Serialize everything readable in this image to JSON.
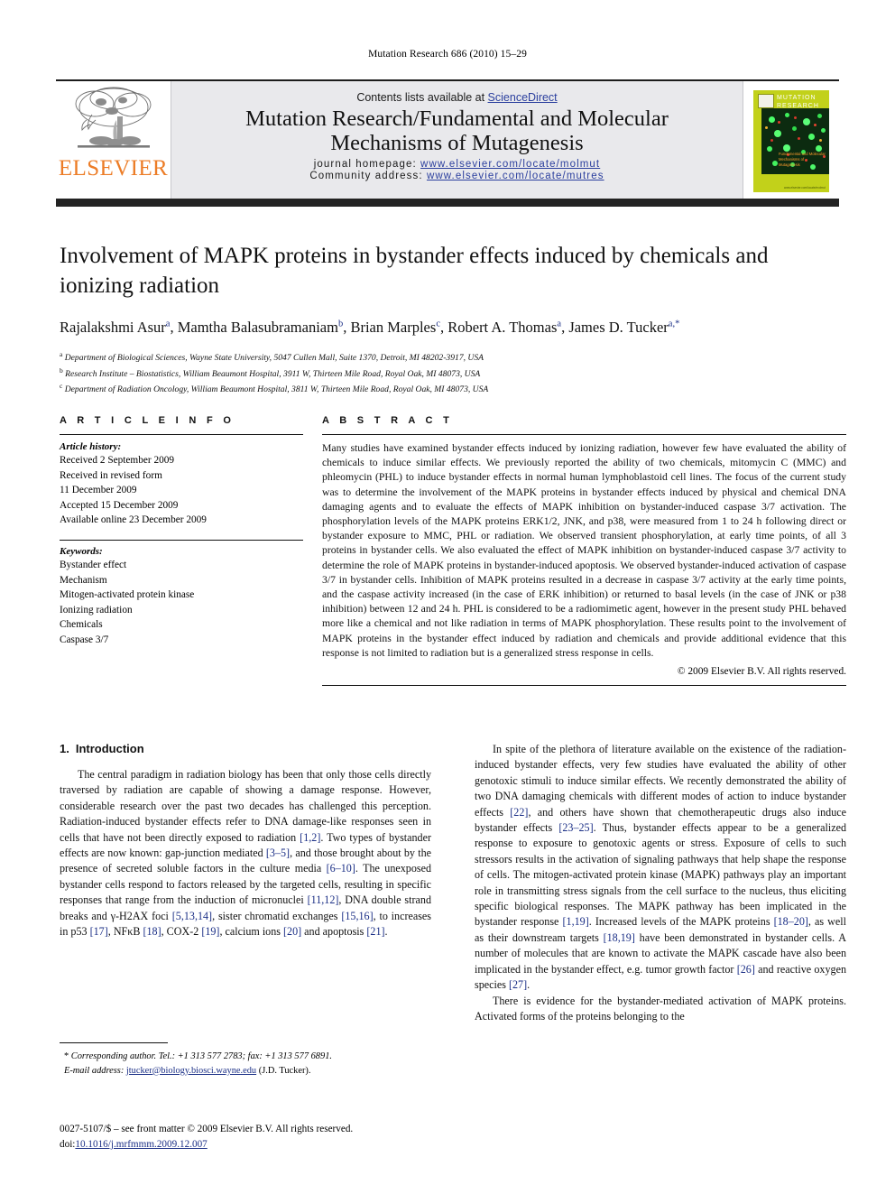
{
  "running_head": "Mutation Research 686 (2010) 15–29",
  "masthead": {
    "publisher_logo_text": "ELSEVIER",
    "contents_prefix": "Contents lists available at ",
    "contents_link": "ScienceDirect",
    "journal_title_line1": "Mutation Research/Fundamental and Molecular",
    "journal_title_line2": "Mechanisms of Mutagenesis",
    "homepage_label": "journal homepage: ",
    "homepage_url": "www.elsevier.com/locate/molmut",
    "community_label": "Community address: ",
    "community_url": "www.elsevier.com/locate/mutres",
    "cover": {
      "title_line1": "MUTATION",
      "title_line2": "RESEARCH",
      "subtitle_line1": "Fundamental and Molecular",
      "subtitle_line2": "Mechanisms of Mutagenesis",
      "footer": "www.elsevier.com/locate/molmut"
    }
  },
  "article": {
    "title": "Involvement of MAPK proteins in bystander effects induced by chemicals and ionizing radiation",
    "authors_html": "Rajalakshmi Asur<sup>a</sup>, Mamtha Balasubramaniam<sup>b</sup>, Brian Marples<sup>c</sup>, Robert A. Thomas<sup>a</sup>, James D. Tucker<sup>a,*</sup>",
    "affiliations": [
      {
        "marker": "a",
        "text": "Department of Biological Sciences, Wayne State University, 5047 Cullen Mall, Suite 1370, Detroit, MI 48202-3917, USA"
      },
      {
        "marker": "b",
        "text": "Research Institute – Biostatistics, William Beaumont Hospital, 3911 W, Thirteen Mile Road, Royal Oak, MI 48073, USA"
      },
      {
        "marker": "c",
        "text": "Department of Radiation Oncology, William Beaumont Hospital, 3811 W, Thirteen Mile Road, Royal Oak, MI 48073, USA"
      }
    ]
  },
  "article_info": {
    "heading": "A R T I C L E   I N F O",
    "history_label": "Article history:",
    "history_lines": [
      "Received 2 September 2009",
      "Received in revised form",
      "11 December 2009",
      "Accepted 15 December 2009",
      "Available online 23 December 2009"
    ],
    "keywords_label": "Keywords:",
    "keywords": [
      "Bystander effect",
      "Mechanism",
      "Mitogen-activated protein kinase",
      "Ionizing radiation",
      "Chemicals",
      "Caspase 3/7"
    ]
  },
  "abstract": {
    "heading": "A B S T R A C T",
    "text": "Many studies have examined bystander effects induced by ionizing radiation, however few have evaluated the ability of chemicals to induce similar effects. We previously reported the ability of two chemicals, mitomycin C (MMC) and phleomycin (PHL) to induce bystander effects in normal human lymphoblastoid cell lines. The focus of the current study was to determine the involvement of the MAPK proteins in bystander effects induced by physical and chemical DNA damaging agents and to evaluate the effects of MAPK inhibition on bystander-induced caspase 3/7 activation. The phosphorylation levels of the MAPK proteins ERK1/2, JNK, and p38, were measured from 1 to 24 h following direct or bystander exposure to MMC, PHL or radiation. We observed transient phosphorylation, at early time points, of all 3 proteins in bystander cells. We also evaluated the effect of MAPK inhibition on bystander-induced caspase 3/7 activity to determine the role of MAPK proteins in bystander-induced apoptosis. We observed bystander-induced activation of caspase 3/7 in bystander cells. Inhibition of MAPK proteins resulted in a decrease in caspase 3/7 activity at the early time points, and the caspase activity increased (in the case of ERK inhibition) or returned to basal levels (in the case of JNK or p38 inhibition) between 12 and 24 h. PHL is considered to be a radiomimetic agent, however in the present study PHL behaved more like a chemical and not like radiation in terms of MAPK phosphorylation. These results point to the involvement of MAPK proteins in the bystander effect induced by radiation and chemicals and provide additional evidence that this response is not limited to radiation but is a generalized stress response in cells.",
    "copyright": "© 2009 Elsevier B.V. All rights reserved."
  },
  "introduction": {
    "number": "1.",
    "heading": "Introduction",
    "left_paragraphs_html": [
      "The central paradigm in radiation biology has been that only those cells directly traversed by radiation are capable of showing a damage response. However, considerable research over the past two decades has challenged this perception. Radiation-induced bystander effects refer to DNA damage-like responses seen in cells that have not been directly exposed to radiation <span class=\"ref\">[1,2]</span>. Two types of bystander effects are now known: gap-junction mediated <span class=\"ref\">[3–5]</span>, and those brought about by the presence of secreted soluble factors in the culture media <span class=\"ref\">[6–10]</span>. The unexposed bystander cells respond to factors released by the targeted cells, resulting in specific responses that range from the induction of micronuclei <span class=\"ref\">[11,12]</span>, DNA double strand breaks and &gamma;-H2AX foci <span class=\"ref\">[5,13,14]</span>, sister chromatid exchanges <span class=\"ref\">[15,16]</span>, to increases in p53 <span class=\"ref\">[17]</span>, NF&kappa;B <span class=\"ref\">[18]</span>, COX-2 <span class=\"ref\">[19]</span>, calcium ions <span class=\"ref\">[20]</span> and apoptosis <span class=\"ref\">[21]</span>."
    ],
    "right_paragraphs_html": [
      "In spite of the plethora of literature available on the existence of the radiation-induced bystander effects, very few studies have evaluated the ability of other genotoxic stimuli to induce similar effects. We recently demonstrated the ability of two DNA damaging chemicals with different modes of action to induce bystander effects <span class=\"ref\">[22]</span>, and others have shown that chemotherapeutic drugs also induce bystander effects <span class=\"ref\">[23–25]</span>. Thus, bystander effects appear to be a generalized response to exposure to genotoxic agents or stress. Exposure of cells to such stressors results in the activation of signaling pathways that help shape the response of cells. The mitogen-activated protein kinase (MAPK) pathways play an important role in transmitting stress signals from the cell surface to the nucleus, thus eliciting specific biological responses. The MAPK pathway has been implicated in the bystander response <span class=\"ref\">[1,19]</span>. Increased levels of the MAPK proteins <span class=\"ref\">[18–20]</span>, as well as their downstream targets <span class=\"ref\">[18,19]</span> have been demonstrated in bystander cells. A number of molecules that are known to activate the MAPK cascade have also been implicated in the bystander effect, e.g. tumor growth factor <span class=\"ref\">[26]</span> and reactive oxygen species <span class=\"ref\">[27]</span>.",
      "There is evidence for the bystander-mediated activation of MAPK proteins. Activated forms of the proteins belonging to the"
    ]
  },
  "footnotes": {
    "corresponding_html": "<span class=\"nonital\">*</span> Corresponding author. Tel.: +1 313 577 2783; fax: +1 313 577 6891.",
    "email_label": "E-mail address:",
    "email": "jtucker@biology.biosci.wayne.edu",
    "email_suffix": "(J.D. Tucker)."
  },
  "imprint": {
    "issn_line": "0027-5107/$ – see front matter © 2009 Elsevier B.V. All rights reserved.",
    "doi_label": "doi:",
    "doi": "10.1016/j.mrfmmm.2009.12.007"
  }
}
